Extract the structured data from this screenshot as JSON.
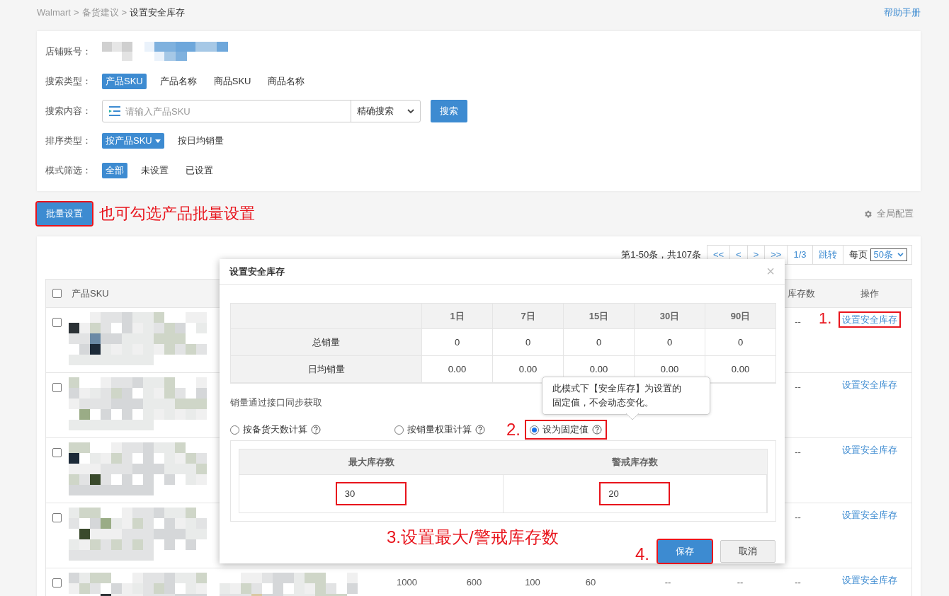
{
  "breadcrumb": [
    {
      "label": "Walmart",
      "separator": ">",
      "current": false
    },
    {
      "label": "备货建议",
      "separator": ">",
      "current": false
    },
    {
      "label": "设置安全库存",
      "current": true
    }
  ],
  "help_link": "帮助手册",
  "filters": {
    "store": {
      "label": "店铺账号："
    },
    "search_type": {
      "label": "搜索类型：",
      "options": [
        {
          "label": "产品SKU",
          "selected": true
        },
        {
          "label": "产品名称",
          "selected": false
        },
        {
          "label": "商品SKU",
          "selected": false
        },
        {
          "label": "商品名称",
          "selected": false
        }
      ]
    },
    "search_content": {
      "label": "搜索内容：",
      "placeholder": "请输入产品SKU",
      "mode": "精确搜索",
      "button": "搜索"
    },
    "sort_type": {
      "label": "排序类型：",
      "options": [
        {
          "label": "按产品SKU",
          "selected": true
        },
        {
          "label": "按日均销量",
          "selected": false
        }
      ]
    },
    "mode_filter": {
      "label": "模式筛选：",
      "options": [
        {
          "label": "全部",
          "selected": true
        },
        {
          "label": "未设置",
          "selected": false
        },
        {
          "label": "已设置",
          "selected": false
        }
      ]
    }
  },
  "batch_button": {
    "label": "批量设置",
    "highlighted": true,
    "note": "也可勾选产品批量设置"
  },
  "global_config": "全局配置",
  "pagination": {
    "summary": "第1-50条，共107条",
    "buttons": [
      "<<",
      "<",
      ">",
      ">>"
    ],
    "page": "1/3",
    "jump": "跳转",
    "per_page_label": "每页",
    "per_page": "50条"
  },
  "table": {
    "select_all": {
      "checked": false
    },
    "columns": [
      {
        "label": "产品SKU"
      },
      {
        "label": "库存数"
      },
      {
        "label": "操作"
      }
    ],
    "rows": [
      {
        "checked": false,
        "warn_stock": "--",
        "action": "设置安全库存",
        "highlighted": true,
        "note": "1."
      },
      {
        "checked": false,
        "warn_stock": "--",
        "action": "设置安全库存",
        "highlighted": false
      },
      {
        "checked": false,
        "warn_stock": "--",
        "action": "设置安全库存",
        "highlighted": false
      },
      {
        "checked": false,
        "warn_stock": "--",
        "action": "设置安全库存",
        "highlighted": false
      },
      {
        "checked": false,
        "metrics": [
          "1000",
          "600",
          "100",
          "60",
          "--",
          "--"
        ],
        "warn_stock": "--",
        "action": "设置安全库存",
        "highlighted": false
      }
    ]
  },
  "modal": {
    "title": "设置安全库存",
    "close": "×",
    "sales_table": {
      "columns": [
        "1日",
        "7日",
        "15日",
        "30日",
        "90日"
      ],
      "rows": [
        {
          "label": "总销量",
          "values": [
            "0",
            "0",
            "0",
            "0",
            "0"
          ]
        },
        {
          "label": "日均销量",
          "values": [
            "0.00",
            "0.00",
            "0.00",
            "0.00",
            "0.00"
          ]
        }
      ]
    },
    "sync_note": "销量通过接口同步获取",
    "modes": [
      {
        "label": "按备货天数计算",
        "selected": false,
        "highlighted": false
      },
      {
        "label": "按销量权重计算",
        "selected": false,
        "highlighted": false
      },
      {
        "label": "设为固定值",
        "selected": true,
        "highlighted": true,
        "note": "2."
      }
    ],
    "tooltip": [
      "此模式下【安全库存】为设置的",
      "固定值，不会动态变化。"
    ],
    "stock_fields": [
      {
        "label": "最大库存数",
        "value": "30",
        "highlighted": true
      },
      {
        "label": "警戒库存数",
        "value": "20",
        "highlighted": true
      }
    ],
    "fields_note": "3.设置最大/警戒库存数",
    "buttons": [
      {
        "label": "保存",
        "kind": "primary",
        "highlighted": true,
        "note": "4."
      },
      {
        "label": "取消",
        "kind": "default",
        "highlighted": false
      }
    ]
  }
}
